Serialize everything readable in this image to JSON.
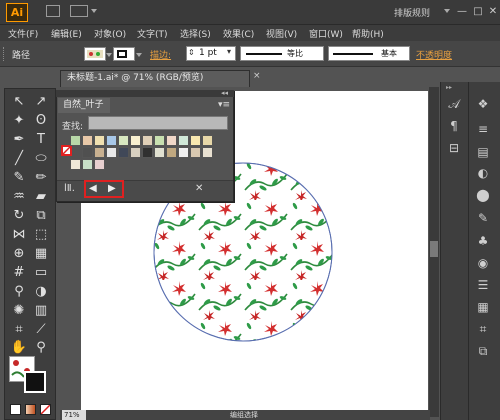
{
  "app": {
    "logo": "Ai",
    "workspace": "排版规则"
  },
  "window_controls": {
    "minimize": "—",
    "maximize": "□",
    "close": "✕"
  },
  "menu": [
    "文件(F)",
    "编辑(E)",
    "对象(O)",
    "文字(T)",
    "选择(S)",
    "效果(C)",
    "视图(V)",
    "窗口(W)",
    "帮助(H)"
  ],
  "control_bar": {
    "selection_label": "路径",
    "stroke_label": "描边:",
    "stroke_weight": "1 pt",
    "profile": "等比",
    "brush": "基本",
    "opacity_label": "不透明度"
  },
  "document": {
    "tab_title": "未标题-1.ai* @ 71% (RGB/预览)",
    "close": "×"
  },
  "swatches_panel": {
    "tab": "自然_叶子",
    "find_label": "查找:",
    "find_value": "",
    "nav_prev": "◀",
    "nav_next": "▶"
  },
  "status_bar": {
    "zoom": "71%",
    "text": "编组选择"
  },
  "colors": {
    "accent": "#ff9a00",
    "highlight": "#e02020",
    "link": "#e8a040"
  },
  "icons": {
    "tools": [
      "selection-arrow-icon",
      "direct-select-icon",
      "magic-wand-icon",
      "lasso-icon",
      "pen-icon",
      "type-icon",
      "line-icon",
      "ellipse-icon",
      "brush-icon",
      "pencil-icon",
      "blob-brush-icon",
      "eraser-icon",
      "rotate-icon",
      "scale-icon",
      "width-icon",
      "free-transform-icon",
      "shape-builder-icon",
      "perspective-icon",
      "mesh-icon",
      "gradient-icon",
      "eyedropper-icon",
      "blend-icon",
      "symbol-sprayer-icon",
      "graph-icon",
      "artboard-icon",
      "slice-icon",
      "hand-icon",
      "zoom-icon"
    ],
    "dock": [
      "type-panel-icon",
      "paragraph-panel-icon",
      "align-panel-icon",
      "layers-panel-icon",
      "color-panel-icon",
      "gradient-panel-icon",
      "appearance-panel-icon",
      "transparency-panel-icon",
      "graphic-styles-icon",
      "brushes-panel-icon",
      "symbols-panel-icon"
    ]
  }
}
